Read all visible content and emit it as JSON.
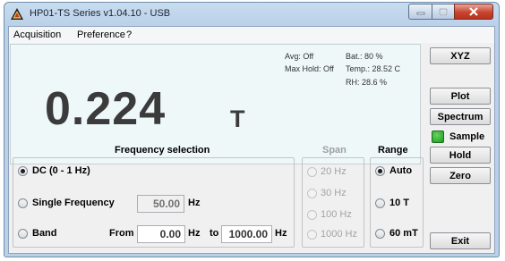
{
  "window": {
    "title": "HP01-TS Series v1.04.10 - USB"
  },
  "menu": [
    "Acquisition",
    "Preference",
    "?"
  ],
  "display": {
    "value": "0.224",
    "unit": "T",
    "avg": "Avg: Off",
    "max_hold": "Max Hold: Off",
    "battery": "Bat.: 80 %",
    "temperature": "Temp.: 28.52 C",
    "humidity": "RH: 28.6 %"
  },
  "buttons": {
    "xyz": "XYZ",
    "plot": "Plot",
    "spectrum": "Spectrum",
    "sample": "Sample",
    "hold": "Hold",
    "zero": "Zero",
    "exit": "Exit"
  },
  "frequency": {
    "header": "Frequency selection",
    "dc_label": "DC (0 - 1 Hz)",
    "single_label": "Single Frequency",
    "single_value": "50.00",
    "single_unit": "Hz",
    "band_label": "Band",
    "from_label": "From",
    "from_value": "0.00",
    "from_unit": "Hz",
    "to_label": "to",
    "to_value": "1000.00",
    "to_unit": "Hz",
    "selected": "dc"
  },
  "span": {
    "header": "Span",
    "options": [
      "20 Hz",
      "30 Hz",
      "100 Hz",
      "1000 Hz"
    ],
    "enabled": false
  },
  "range": {
    "header": "Range",
    "options": [
      "Auto",
      "10 T",
      "60 mT"
    ],
    "selected": "Auto"
  },
  "colors": {
    "display_bg": "#eef8f8",
    "sample_led": "#2fb82f",
    "close_button": "#c9442f"
  }
}
